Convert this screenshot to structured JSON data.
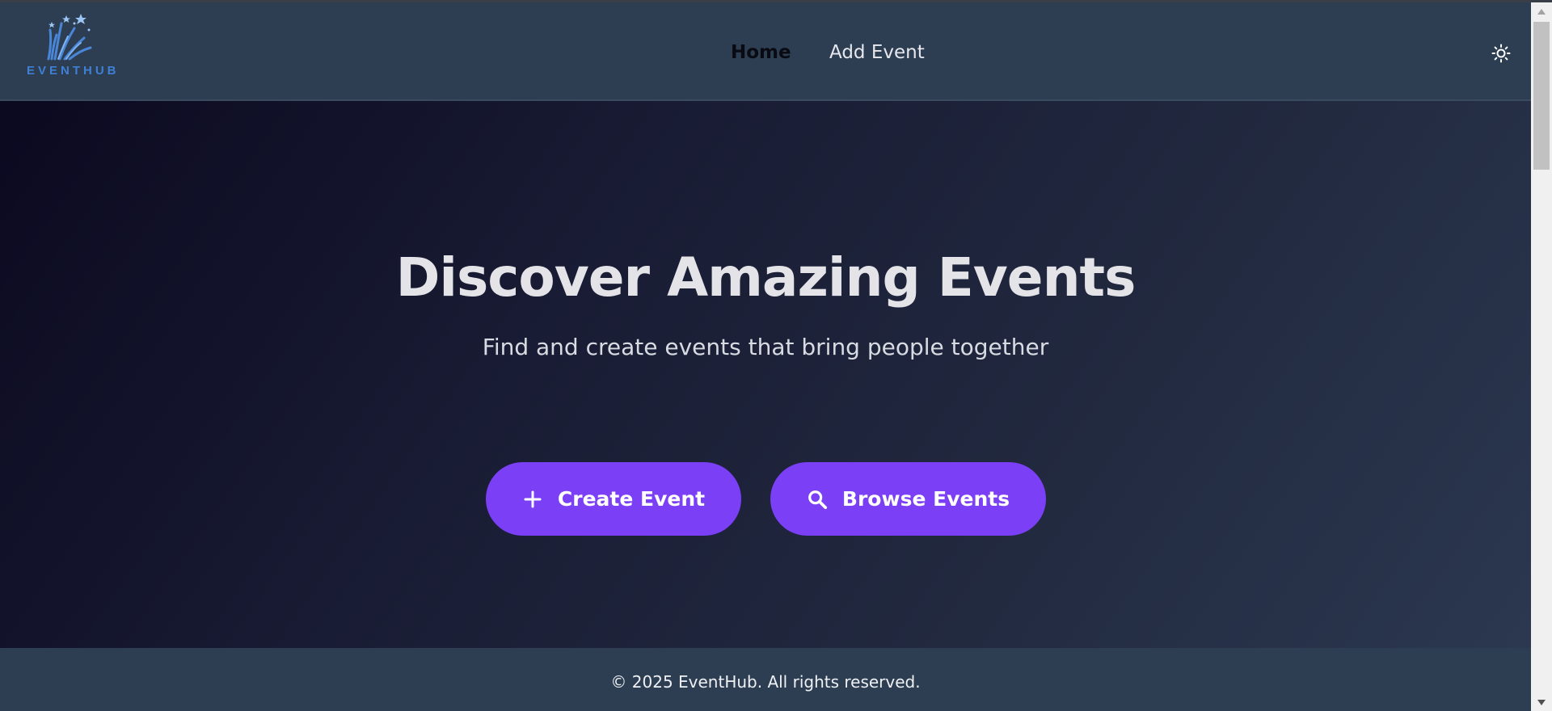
{
  "brand": {
    "logo_text": "EVENTHUB",
    "accent_color": "#3f7fd4"
  },
  "nav": {
    "items": [
      {
        "label": "Home",
        "active": true
      },
      {
        "label": "Add Event",
        "active": false
      }
    ],
    "theme_toggle_icon": "sun-icon"
  },
  "hero": {
    "title": "Discover Amazing Events",
    "subtitle": "Find and create events that bring people together",
    "buttons": [
      {
        "label": "Create Event",
        "icon": "plus-icon"
      },
      {
        "label": "Browse Events",
        "icon": "search-icon"
      }
    ],
    "button_color": "#7b3ff5"
  },
  "footer": {
    "text": "© 2025 EventHub. All rights reserved."
  },
  "colors": {
    "navbar_bg": "#2d3e52",
    "hero_gradient_start": "#0b0920",
    "hero_gradient_end": "#2b3850"
  }
}
